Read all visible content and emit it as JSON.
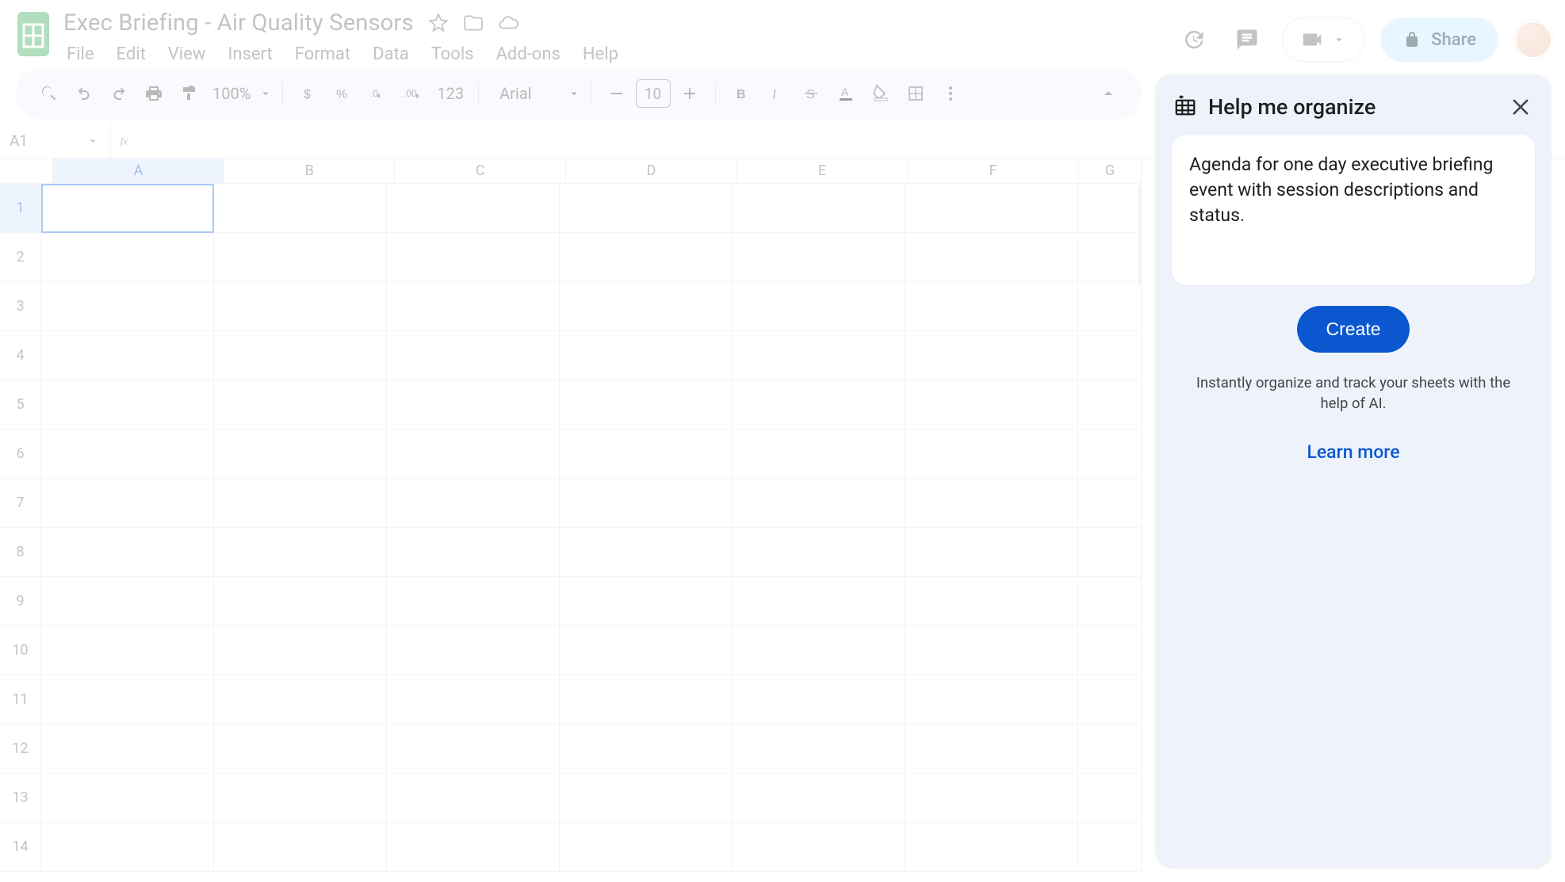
{
  "doc": {
    "title": "Exec Briefing - Air Quality Sensors"
  },
  "menus": [
    "File",
    "Edit",
    "View",
    "Insert",
    "Format",
    "Data",
    "Tools",
    "Add-ons",
    "Help"
  ],
  "toolbar": {
    "zoom": "100%",
    "number_format": "123",
    "font": "Arial",
    "font_size": "10"
  },
  "share_label": "Share",
  "namebox": "A1",
  "columns": [
    "A",
    "B",
    "C",
    "D",
    "E",
    "F",
    "G"
  ],
  "rows": [
    "1",
    "2",
    "3",
    "4",
    "5",
    "6",
    "7",
    "8",
    "9",
    "10",
    "11",
    "12",
    "13",
    "14"
  ],
  "selected_cell": {
    "col": 0,
    "row": 0
  },
  "side_panel": {
    "title": "Help me organize",
    "prompt": "Agenda for one day executive briefing event with session descriptions and status.",
    "create_label": "Create",
    "hint": "Instantly organize and track your sheets with the help of AI.",
    "learn_more": "Learn more"
  }
}
